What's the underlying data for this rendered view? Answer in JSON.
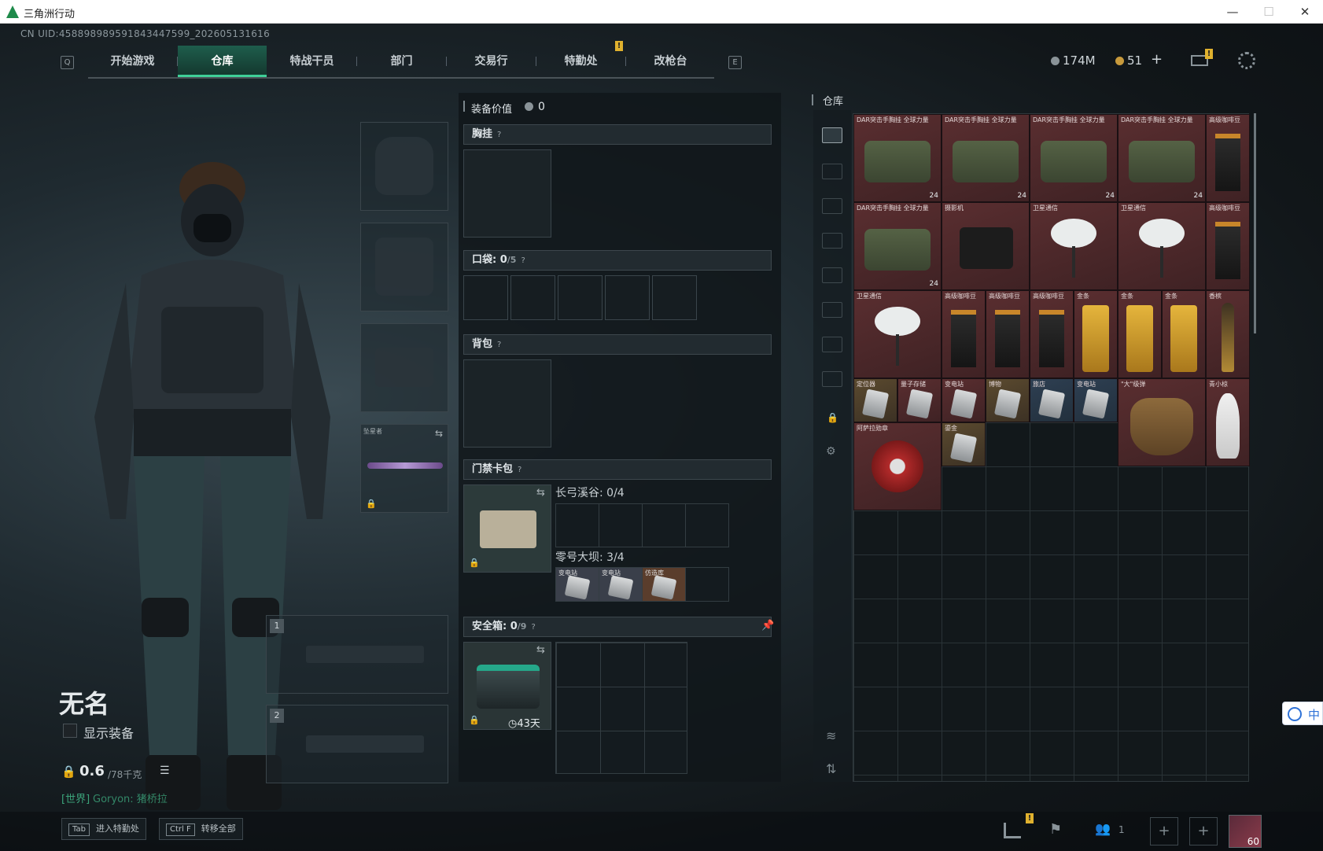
{
  "window": {
    "title": "三角洲行动",
    "min_label": "—",
    "max_label": "☐",
    "close_label": "✕"
  },
  "uid": "CN UID:4588989895918434475​99_202605131616",
  "nav": {
    "left_key": "Q",
    "right_key": "E",
    "tabs": [
      {
        "label": "开始游戏"
      },
      {
        "label": "仓库"
      },
      {
        "label": "特战干员"
      },
      {
        "label": "部门"
      },
      {
        "label": "交易行"
      },
      {
        "label": "特勤处"
      },
      {
        "label": "改枪台"
      }
    ],
    "alert_badge": "!"
  },
  "currency": {
    "silver": "174M",
    "gold": "51",
    "add": "+"
  },
  "player": {
    "name": "无名",
    "show_equipment": "显示装备",
    "weight": "0.6",
    "weight_max": "/78千克",
    "chat_channel": "[世界]",
    "chat_text": "Goryon: 猪桥拉"
  },
  "equip": {
    "secondary_weapon_label": "坠星者",
    "weapon1_num": "1",
    "weapon2_num": "2"
  },
  "gear_panel": {
    "value_label": "装备价值",
    "value": "0",
    "chest_rig": "胸挂",
    "pockets": "口袋:",
    "pockets_count": "0",
    "pockets_max": "/5",
    "backpack": "背包",
    "keycard": "门禁卡包",
    "map1": "长弓溪谷: 0/4",
    "map2": "零号大坝: 3/4",
    "card_items": [
      "变电站",
      "变电站",
      "仿造库"
    ],
    "safebox": "安全箱:",
    "safebox_count": "0",
    "safebox_max": "/9",
    "safebox_timer": "43天",
    "question": "?"
  },
  "warehouse": {
    "title": "仓库",
    "items": [
      {
        "name": "DAR突击手胸挂 全球力量",
        "count": "24",
        "art": "bag",
        "tone": "red"
      },
      {
        "name": "DAR突击手胸挂 全球力量",
        "count": "24",
        "art": "bag",
        "tone": "red"
      },
      {
        "name": "DAR突击手胸挂 全球力量",
        "count": "24",
        "art": "bag",
        "tone": "red"
      },
      {
        "name": "DAR突击手胸挂 全球力量",
        "count": "24",
        "art": "bag",
        "tone": "red"
      },
      {
        "name": "高级咖啡豆",
        "count": "",
        "art": "coffee",
        "tone": "red"
      },
      {
        "name": "DAR突击手胸挂 全球力量",
        "count": "24",
        "art": "bag",
        "tone": "red"
      },
      {
        "name": "摄影机",
        "count": "",
        "art": "cam",
        "tone": "red"
      },
      {
        "name": "卫星通信",
        "count": "",
        "art": "dish",
        "tone": "red"
      },
      {
        "name": "卫星通信",
        "count": "",
        "art": "dish",
        "tone": "red"
      },
      {
        "name": "高级咖啡豆",
        "count": "",
        "art": "coffee",
        "tone": "red"
      },
      {
        "name": "卫星通信",
        "count": "",
        "art": "dish",
        "tone": "red"
      },
      {
        "name": "高级咖啡豆",
        "count": "",
        "art": "coffee",
        "tone": "red"
      },
      {
        "name": "高级咖啡豆",
        "count": "",
        "art": "coffee",
        "tone": "red"
      },
      {
        "name": "高级咖啡豆",
        "count": "",
        "art": "coffee",
        "tone": "red"
      },
      {
        "name": "金条",
        "count": "",
        "art": "bar",
        "tone": "red"
      },
      {
        "name": "金条",
        "count": "",
        "art": "bar",
        "tone": "red"
      },
      {
        "name": "金条",
        "count": "",
        "art": "bar",
        "tone": "red"
      },
      {
        "name": "香槟",
        "count": "",
        "art": "bottle",
        "tone": "red"
      },
      {
        "name": "定位器",
        "count": "",
        "art": "card",
        "tone": "gold"
      },
      {
        "name": "量子存储",
        "count": "",
        "art": "card",
        "tone": "red"
      },
      {
        "name": "变电站",
        "count": "",
        "art": "card",
        "tone": "red"
      },
      {
        "name": "博物",
        "count": "",
        "art": "card",
        "tone": "gold"
      },
      {
        "name": "旅店",
        "count": "",
        "art": "card",
        "tone": "blue"
      },
      {
        "name": "变电站",
        "count": "",
        "art": "card",
        "tone": "blue"
      },
      {
        "name": "\"大\"级弹",
        "count": "",
        "art": "glove",
        "tone": "red"
      },
      {
        "name": "青小椋",
        "count": "",
        "art": "fig",
        "tone": "red"
      },
      {
        "name": "阿萨拉勋章",
        "count": "",
        "art": "med",
        "tone": "red"
      },
      {
        "name": "鎏金",
        "count": "",
        "art": "card",
        "tone": "gold"
      }
    ]
  },
  "bottom": {
    "hint1_key": "Tab",
    "hint1": "进入特勤处",
    "hint2_key": "Ctrl F",
    "hint2": "转移全部",
    "friends": "1",
    "level": "60"
  },
  "ime": {
    "label": "中"
  },
  "colors": {
    "accent": "#3fcf98",
    "red_rarity": "#5a2e30",
    "gold_rarity": "#5b4a2f",
    "badge": "#e0b12e"
  }
}
